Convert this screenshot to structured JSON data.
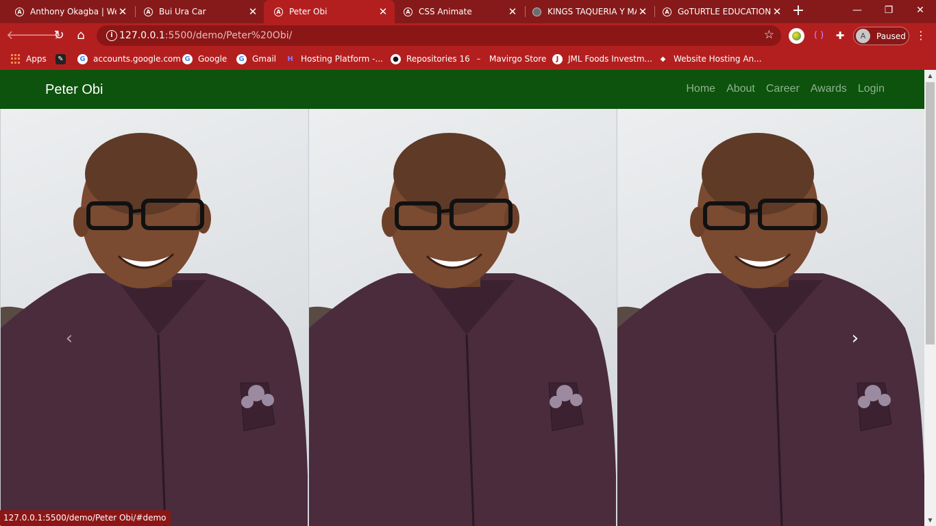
{
  "browser": {
    "tabs": [
      {
        "title": "Anthony Okagba | Web",
        "favicon": "app-icon"
      },
      {
        "title": "Bui Ura Car",
        "favicon": "app-icon"
      },
      {
        "title": "Peter Obi",
        "favicon": "app-icon",
        "active": true
      },
      {
        "title": "CSS Animate",
        "favicon": "app-icon"
      },
      {
        "title": "KINGS TAQUERIA Y MA",
        "favicon": "globe-icon"
      },
      {
        "title": "GoTURTLE EDUCATION",
        "favicon": "app-icon"
      }
    ],
    "close_glyph": "✕",
    "new_tab_glyph": "+",
    "window_controls": {
      "minimize": "—",
      "restore": "❐",
      "close": "✕"
    },
    "url": {
      "host": "127.0.0.1",
      "path": ":5500/demo/Peter%20Obi/"
    },
    "profile": {
      "initial": "A",
      "status": "Paused"
    },
    "bookmarks": [
      {
        "label": "Apps",
        "icon": "apps-grid-icon"
      },
      {
        "label": "",
        "icon": "tool-icon"
      },
      {
        "label": "accounts.google.com",
        "icon": "google-icon"
      },
      {
        "label": "Google",
        "icon": "google-icon"
      },
      {
        "label": "Gmail",
        "icon": "google-icon"
      },
      {
        "label": "Hosting Platform -...",
        "icon": "hosting-icon"
      },
      {
        "label": "Repositories 16",
        "icon": "github-icon"
      },
      {
        "label": "Mavirgo Store",
        "icon": "mavirgo-icon"
      },
      {
        "label": "JML Foods Investm...",
        "icon": "jml-icon"
      },
      {
        "label": "Website Hosting An...",
        "icon": "webhost-icon"
      }
    ],
    "status_url": "127.0.0.1:5500/demo/Peter Obi/#demo"
  },
  "site": {
    "brand": "Peter Obi",
    "nav": [
      "Home",
      "About",
      "Career",
      "Awards",
      "Login"
    ],
    "colors": {
      "nav_bg": "#0d520d",
      "nav_link": "#8fb38f",
      "browser_red": "#b31f1f"
    },
    "carousel": {
      "slides": 3,
      "prev_glyph": "‹",
      "next_glyph": "›"
    }
  }
}
